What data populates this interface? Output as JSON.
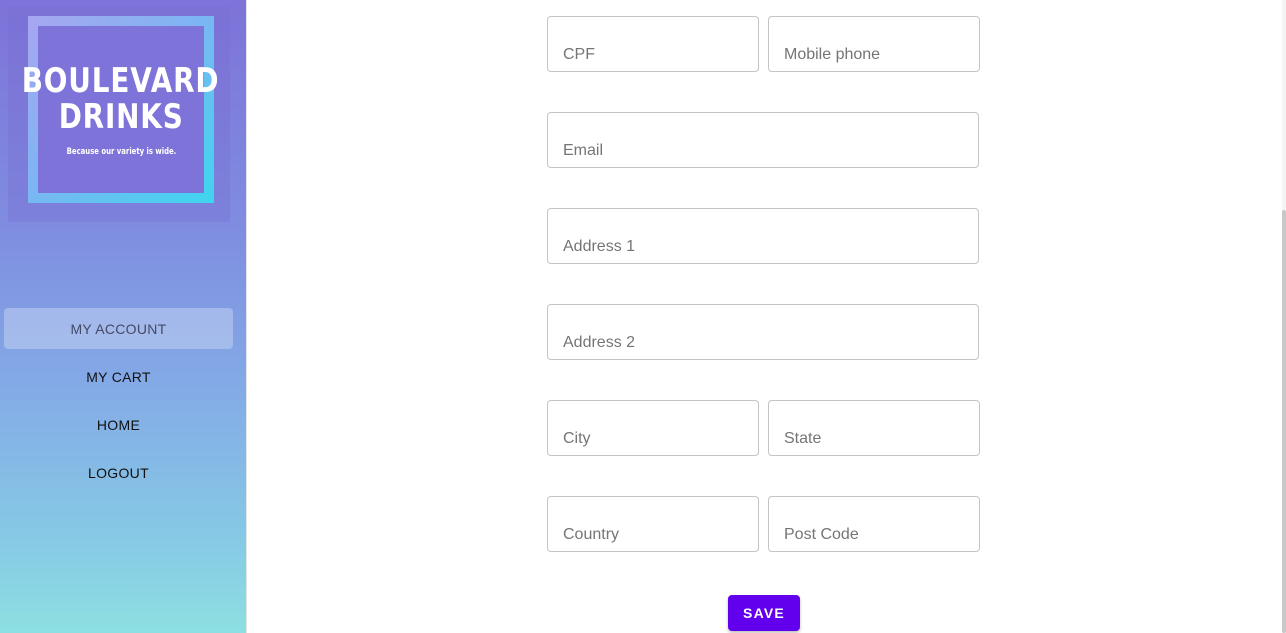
{
  "brand": {
    "name_line1": "BOULEVARD",
    "name_line2": "DRINKS",
    "tagline": "Because our variety is wide."
  },
  "nav": {
    "items": [
      {
        "label": "MY ACCOUNT",
        "active": true
      },
      {
        "label": "MY CART",
        "active": false
      },
      {
        "label": "HOME",
        "active": false
      },
      {
        "label": "LOGOUT",
        "active": false
      }
    ]
  },
  "form": {
    "cpf": {
      "placeholder": "CPF",
      "value": ""
    },
    "mobile_phone": {
      "placeholder": "Mobile phone",
      "value": ""
    },
    "email": {
      "placeholder": "Email",
      "value": ""
    },
    "address1": {
      "placeholder": "Address 1",
      "value": ""
    },
    "address2": {
      "placeholder": "Address 2",
      "value": ""
    },
    "city": {
      "placeholder": "City",
      "value": ""
    },
    "state": {
      "placeholder": "State",
      "value": ""
    },
    "country": {
      "placeholder": "Country",
      "value": ""
    },
    "post_code": {
      "placeholder": "Post Code",
      "value": ""
    },
    "save_label": "SAVE"
  },
  "colors": {
    "accent": "#6200ee",
    "sidebar_top": "#7d73d9",
    "sidebar_bottom": "#8de0e2"
  }
}
